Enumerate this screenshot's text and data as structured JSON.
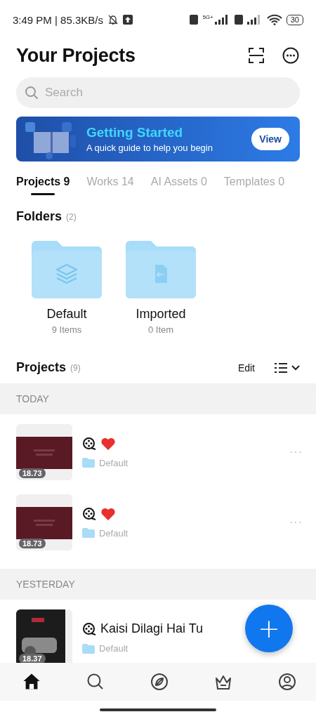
{
  "status_bar": {
    "time": "3:49 PM | 85.3KB/s",
    "network_label": "5G+",
    "battery": "30"
  },
  "header": {
    "title": "Your Projects"
  },
  "search": {
    "placeholder": "Search"
  },
  "banner": {
    "title": "Getting Started",
    "subtitle": "A quick guide to help you begin",
    "button": "View"
  },
  "tabs": [
    {
      "label": "Projects 9",
      "selected": true
    },
    {
      "label": "Works 14",
      "selected": false
    },
    {
      "label": "AI Assets 0",
      "selected": false
    },
    {
      "label": "Templates 0",
      "selected": false
    }
  ],
  "folders": {
    "title": "Folders",
    "count": "(2)",
    "items": [
      {
        "name": "Default",
        "count": "9 Items",
        "kind": "layers"
      },
      {
        "name": "Imported",
        "count": "0 Item",
        "kind": "import"
      }
    ]
  },
  "projects": {
    "title": "Projects",
    "count": "(9)",
    "edit": "Edit",
    "groups": [
      {
        "label": "TODAY",
        "rows": [
          {
            "duration": "18.73",
            "heart": true,
            "folder": "Default",
            "menu": "···"
          },
          {
            "duration": "18.73",
            "heart": true,
            "folder": "Default",
            "menu": "···"
          }
        ]
      },
      {
        "label": "YESTERDAY",
        "rows": [
          {
            "duration": "18.37",
            "title": "Kaisi Dilagi Hai Tu",
            "heart": false,
            "folder": "Default"
          }
        ]
      }
    ]
  },
  "fab": {
    "label": "+"
  },
  "nav": [
    {
      "kind": "home",
      "selected": true
    },
    {
      "kind": "search",
      "selected": false
    },
    {
      "kind": "compass",
      "selected": false
    },
    {
      "kind": "crown",
      "selected": false
    },
    {
      "kind": "profile",
      "selected": false
    }
  ]
}
